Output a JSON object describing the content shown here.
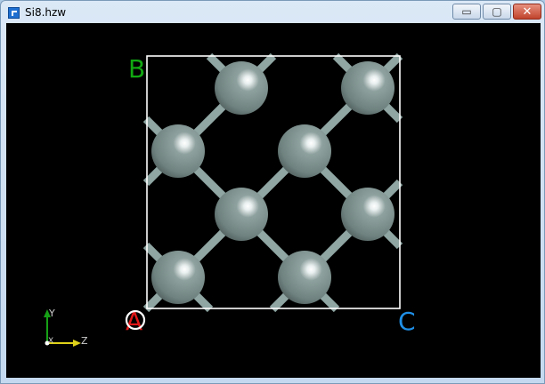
{
  "window": {
    "title": "Si8.hzw",
    "minimize_glyph": "▭",
    "maximize_glyph": "▢",
    "close_glyph": "✕"
  },
  "viewer": {
    "corner_labels": {
      "a": "A",
      "b": "B",
      "c": "C"
    },
    "axis_labels": {
      "y": "Y",
      "x": "X",
      "z": "Z"
    },
    "colors": {
      "background": "#000000",
      "cell_border": "#ffffff",
      "atom": "#708682",
      "bond": "#8fa6a3",
      "label_a": "#e01818",
      "label_b": "#11a811",
      "label_c": "#1f8fe6",
      "axis_y": "#16a016",
      "axis_z": "#e0d21a"
    }
  }
}
